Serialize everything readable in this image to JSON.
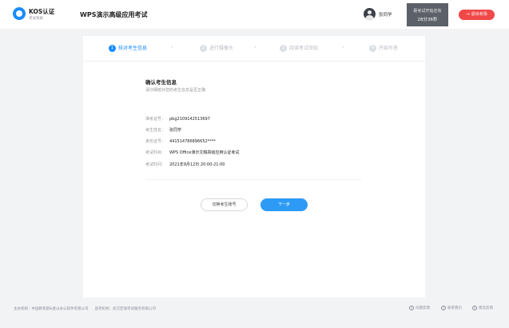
{
  "header": {
    "brand_name": "KOS认证",
    "brand_sub": "考试系统",
    "exam_title": "WPS演示高级应用考试",
    "user_name": "张同学",
    "countdown_label": "距考试开始还有",
    "countdown_value": "28分36秒",
    "exit_label": "退出考场"
  },
  "steps": [
    {
      "num": "1",
      "label": "核对考生信息"
    },
    {
      "num": "2",
      "label": "进行摄像头"
    },
    {
      "num": "3",
      "label": "阅读考试须知"
    },
    {
      "num": "4",
      "label": "开始作答"
    }
  ],
  "step_separator": "›",
  "confirm": {
    "title": "确认考生信息",
    "subtitle": "请仔细核对您的考生信息是否正确"
  },
  "info": [
    {
      "label": "准考证号：",
      "value": "pbg2109142513697"
    },
    {
      "label": "考生姓名：",
      "value": "张同学"
    },
    {
      "label": "身份证号：",
      "value": "441514786896652****"
    },
    {
      "label": "考试科目：",
      "value": "WPS Office演示文稿高级应用认证考试"
    },
    {
      "label": "考试时间：",
      "value": "2021年9月12日 20:00-21:00"
    }
  ],
  "buttons": {
    "switch_label": "切换考生账号",
    "next_label": "下一步"
  },
  "footer": {
    "organizer": "主办机构：中国教育部&金山办公软件有限公司",
    "supervisor": "监考机构：武汉宏瑞考试服务有限公司",
    "links": [
      {
        "icon": "?",
        "label": "问题反馈"
      },
      {
        "icon": "?",
        "label": "联系我们"
      },
      {
        "icon": "?",
        "label": "意见反馈"
      }
    ]
  },
  "colors": {
    "accent": "#1a8cff",
    "next_button": "#2d9bf5",
    "exit_button": "#f04848",
    "countdown_bg": "#5c6068"
  }
}
